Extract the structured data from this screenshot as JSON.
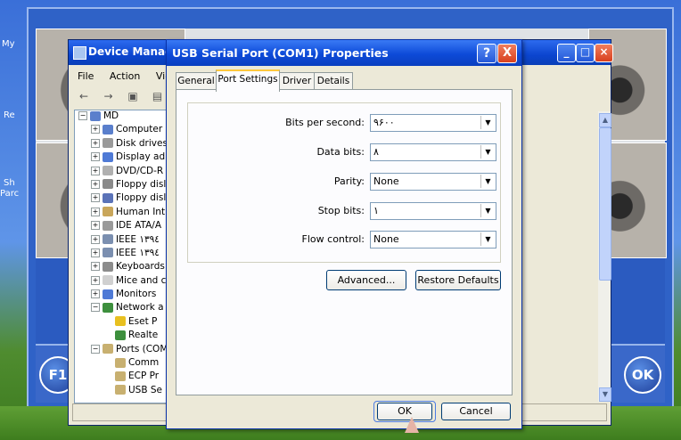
{
  "desktop": {
    "left_labels": [
      "My",
      "Re",
      "Sh",
      "Parc"
    ],
    "fn_button": "F1",
    "ok_button": "OK"
  },
  "device_manager": {
    "title": "Device Manager",
    "menu": [
      "File",
      "Action",
      "View"
    ],
    "tree": [
      {
        "label": "MD",
        "expander": "−",
        "indent": 0,
        "icon": "computer-icon",
        "color": "#5a7fcc"
      },
      {
        "label": "Computer",
        "expander": "+",
        "indent": 1,
        "icon": "computer-icon",
        "color": "#5a7fcc"
      },
      {
        "label": "Disk drives",
        "expander": "+",
        "indent": 1,
        "icon": "disk-drive-icon",
        "color": "#9a9a9a"
      },
      {
        "label": "Display ad",
        "expander": "+",
        "indent": 1,
        "icon": "display-icon",
        "color": "#4f7ad6"
      },
      {
        "label": "DVD/CD-R",
        "expander": "+",
        "indent": 1,
        "icon": "cdrom-icon",
        "color": "#b0b0b0"
      },
      {
        "label": "Floppy disl",
        "expander": "+",
        "indent": 1,
        "icon": "floppy-icon",
        "color": "#8a8a8a"
      },
      {
        "label": "Floppy disl",
        "expander": "+",
        "indent": 1,
        "icon": "floppy-icon",
        "color": "#5b73b8"
      },
      {
        "label": "Human Int",
        "expander": "+",
        "indent": 1,
        "icon": "hid-icon",
        "color": "#c9a65a"
      },
      {
        "label": "IDE ATA/A",
        "expander": "+",
        "indent": 1,
        "icon": "ide-icon",
        "color": "#9a9a9a"
      },
      {
        "label": "IEEE ١٣٩٤",
        "expander": "+",
        "indent": 1,
        "icon": "ieee-icon",
        "color": "#7b8fb0"
      },
      {
        "label": "IEEE ١٣٩٤",
        "expander": "+",
        "indent": 1,
        "icon": "ieee-icon",
        "color": "#7b8fb0"
      },
      {
        "label": "Keyboards",
        "expander": "+",
        "indent": 1,
        "icon": "keyboard-icon",
        "color": "#8c8c8c"
      },
      {
        "label": "Mice and c",
        "expander": "+",
        "indent": 1,
        "icon": "mouse-icon",
        "color": "#d0d0d0"
      },
      {
        "label": "Monitors",
        "expander": "+",
        "indent": 1,
        "icon": "monitor-icon",
        "color": "#4f7ad6"
      },
      {
        "label": "Network a",
        "expander": "−",
        "indent": 1,
        "icon": "network-icon",
        "color": "#3d8f3d"
      },
      {
        "label": "Eset P",
        "expander": "",
        "indent": 2,
        "icon": "warning-icon",
        "color": "#e8c020"
      },
      {
        "label": "Realte",
        "expander": "",
        "indent": 2,
        "icon": "network-card-icon",
        "color": "#3d8f3d"
      },
      {
        "label": "Ports (COM",
        "expander": "−",
        "indent": 1,
        "icon": "port-icon",
        "color": "#c8b070"
      },
      {
        "label": "Comm",
        "expander": "",
        "indent": 2,
        "icon": "port-icon",
        "color": "#c8b070"
      },
      {
        "label": "ECP Pr",
        "expander": "",
        "indent": 2,
        "icon": "port-icon",
        "color": "#c8b070"
      },
      {
        "label": "USB Se",
        "expander": "",
        "indent": 2,
        "icon": "port-icon",
        "color": "#c8b070"
      }
    ]
  },
  "dialog": {
    "title": "USB Serial Port (COM1) Properties",
    "help": "?",
    "close": "X",
    "tabs": [
      "General",
      "Port Settings",
      "Driver",
      "Details"
    ],
    "active_tab": "Port Settings",
    "fields": [
      {
        "label": "Bits per second:",
        "value": "٩۶٠٠"
      },
      {
        "label": "Data bits:",
        "value": "٨"
      },
      {
        "label": "Parity:",
        "value": "None"
      },
      {
        "label": "Stop bits:",
        "value": "١"
      },
      {
        "label": "Flow control:",
        "value": "None"
      }
    ],
    "advanced_label": "Advanced...",
    "restore_label": "Restore Defaults",
    "ok_label": "OK",
    "cancel_label": "Cancel"
  }
}
